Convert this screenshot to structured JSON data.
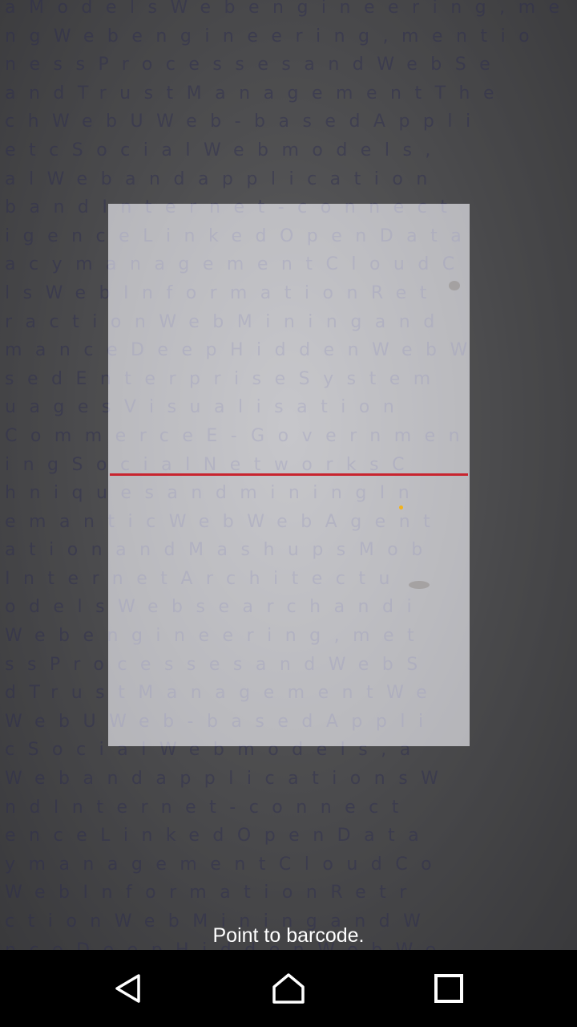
{
  "scanner": {
    "status_text": "Point to barcode.",
    "laser_color": "#c8242e",
    "point_color": "#f2b21c",
    "background_text": [
      "aModelsWebengineering,me",
      "ngWebengineering,mentio",
      "nessProcessesandWebSe",
      "andTrustManagementThe",
      "chWebUWeb-basedAppli",
      "etcSocialWebmodels,",
      "alWebandapplication",
      "bandInternet-connect",
      "igenceLinkedOpenData",
      "acymanagementCloudC",
      "lsWebInformationRet",
      "ractionWebMiningand",
      "manceDeepHiddenWebW",
      "sedEnterpriseSystem",
      "uagesVisualisation",
      "CommerceE-Governmen",
      "ingSocialNetworksC",
      "hniquesandminingIn",
      "emanticWebWebAgent",
      "ationandMashupsMob",
      "InternetArchitectu",
      "odelsWebsearchandi",
      "Webengineering,met",
      "ssProcessesandWebS",
      "dTrustManagementWe",
      "WebUWeb-basedAppli",
      "cSocialWebmodels,a",
      "WebandapplicationsW",
      "ndInternet-connect",
      "enceLinkedOpenData",
      "ymanagementCloudCo",
      "WebInformationRetr",
      "ctionWebMiningandW",
      "nceDeepHiddenWebWe"
    ]
  },
  "navbar": {
    "back_icon": "triangle-back-icon",
    "home_icon": "circle-home-icon",
    "recent_icon": "square-recents-icon"
  }
}
